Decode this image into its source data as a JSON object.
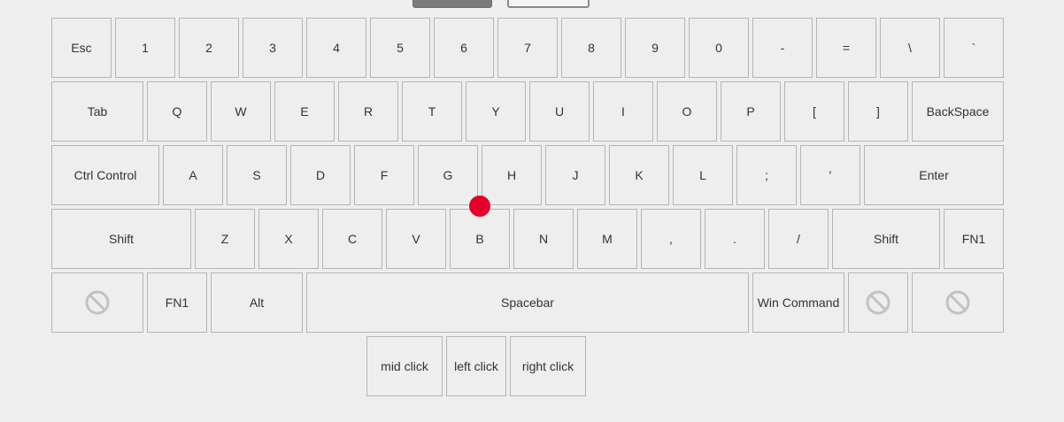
{
  "top_buttons": [
    {
      "name": "top-button-primary",
      "style": "dark"
    },
    {
      "name": "top-button-secondary",
      "style": "light"
    }
  ],
  "keyboard": {
    "row1": [
      "Esc",
      "1",
      "2",
      "3",
      "4",
      "5",
      "6",
      "7",
      "8",
      "9",
      "0",
      "-",
      "=",
      "\\",
      "`"
    ],
    "row2": [
      "Tab",
      "Q",
      "W",
      "E",
      "R",
      "T",
      "Y",
      "U",
      "I",
      "O",
      "P",
      "[",
      "]",
      "BackSpace"
    ],
    "row3": [
      "Ctrl Control",
      "A",
      "S",
      "D",
      "F",
      "G",
      "H",
      "J",
      "K",
      "L",
      ";",
      "'",
      "Enter"
    ],
    "row4": [
      "Shift",
      "Z",
      "X",
      "C",
      "V",
      "B",
      "N",
      "M",
      ",",
      ".",
      "/",
      "Shift",
      "FN1"
    ],
    "row5": [
      "",
      "FN1",
      "Alt",
      "Spacebar",
      "Win Command",
      "",
      ""
    ],
    "mouse": [
      "mid click",
      "left click",
      "right click"
    ]
  },
  "disabled_icon": "no-entry-icon",
  "cursor": {
    "color": "#e4002b"
  }
}
